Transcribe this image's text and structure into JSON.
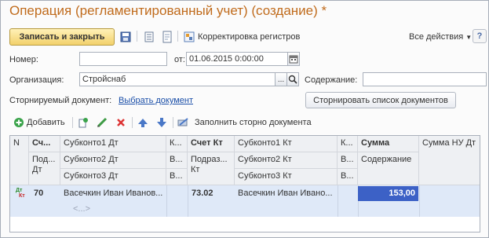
{
  "title": "Операция (регламентированный учет) (создание) *",
  "toolbar": {
    "save_close": "Записать и закрыть",
    "registers": "Корректировка регистров",
    "all_actions": "Все действия",
    "help": "?"
  },
  "form": {
    "number_label": "Номер:",
    "number_value": "",
    "from_label": "от:",
    "date_value": "01.06.2015  0:00:00",
    "org_label": "Организация:",
    "org_value": "Стройснаб",
    "content_label": "Содержание:",
    "content_value": "",
    "storno_label": "Сторнируемый документ:",
    "storno_link": "Выбрать документ",
    "storno_list_button": "Сторнировать список документов",
    "ellipsis": "..."
  },
  "table_toolbar": {
    "add": "Добавить",
    "fill_storno": "Заполнить сторно документа"
  },
  "table": {
    "headers": {
      "n": "N",
      "sch_dt": "Сч...",
      "podr_dt": "Под... Дт",
      "sub1_dt": "Субконто1 Дт",
      "sub2_dt": "Субконто2 Дт",
      "sub3_dt": "Субконто3 Дт",
      "k1": "К...",
      "v1a": "В...",
      "v1b": "В...",
      "sch_kt": "Счет Кт",
      "podr_kt": "Подраз... Кт",
      "sub1_kt": "Субконто1 Кт",
      "sub2_kt": "Субконто2 Кт",
      "sub3_kt": "Субконто3 Кт",
      "k2": "К...",
      "v2a": "В...",
      "v2b": "В...",
      "summa": "Сумма",
      "soderzhanie": "Содержание",
      "summa_nu": "Сумма НУ Дт"
    },
    "row": {
      "icon_dt": "Дт",
      "icon_kt": "Кт",
      "sch_dt": "70",
      "sub1_dt": "Васечкин Иван Иванов...",
      "sch_kt": "73.02",
      "sub1_kt": "Васечкин Иван Ивано...",
      "summa": "153,00",
      "placeholder": "<...>"
    }
  },
  "icons": [
    "save-icon",
    "list-icon",
    "doc-icon",
    "registers-icon",
    "add-icon",
    "copy-icon",
    "edit-icon",
    "delete-icon",
    "up-icon",
    "down-icon",
    "storno-icon",
    "calendar-icon",
    "search-icon"
  ],
  "colors": {
    "title": "#c06b1c",
    "accent_button": "#f2d16b",
    "selection": "#3c61c6",
    "row": "#dfe9f8",
    "link": "#1b4fa8"
  }
}
